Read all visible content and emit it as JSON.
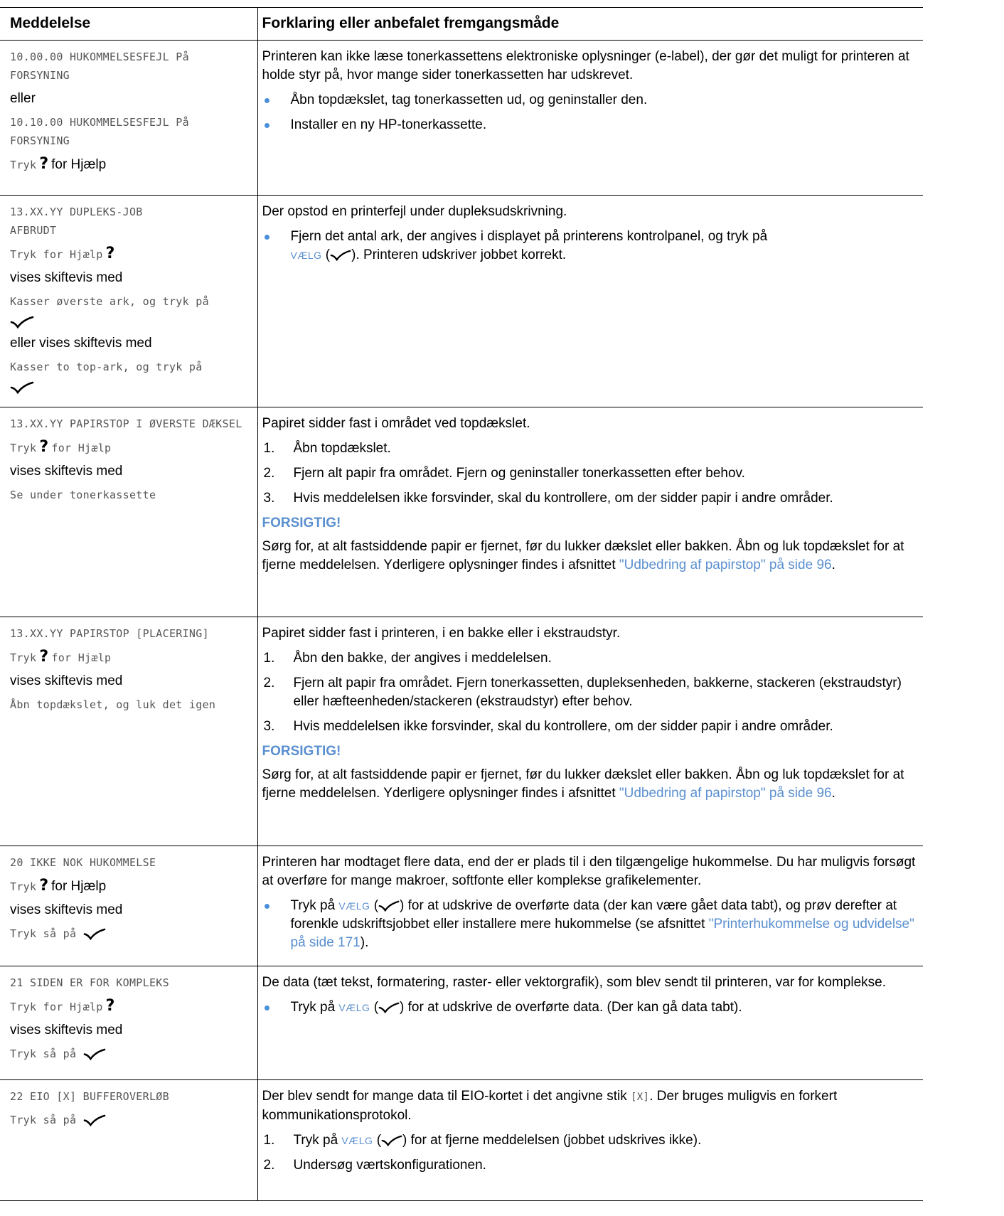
{
  "header": {
    "col1": "Meddelelse",
    "col2": "Forklaring eller anbefalet fremgangsmåde"
  },
  "rows": {
    "r1": {
      "m1": "10.00.00 HUKOMMELSESFEJL På FORSYNING",
      "or": "eller",
      "m2": "10.10.00 HUKOMMELSESFEJL På FORSYNING",
      "help_pre": "Tryk",
      "help_post": "for Hjælp",
      "desc": "Printeren kan ikke læse tonerkassettens elektroniske oplysninger (e-label), der gør det muligt for printeren at holde styr på, hvor mange sider tonerkassetten har udskrevet.",
      "b1": "Åbn topdækslet, tag tonerkassetten ud, og geninstaller den.",
      "b2": "Installer en ny HP-tonerkassette."
    },
    "r2": {
      "m1": "13.XX.YY DUPLEKS-JOB AFBRUDT",
      "help": "Tryk for Hjælp",
      "alt": "vises skiftevis med",
      "m2": "Kasser øverste ark, og tryk på",
      "alt2": "eller vises skiftevis med",
      "m3": "Kasser to top-ark, og tryk på",
      "desc": "Der opstod en printerfejl under dupleksudskrivning.",
      "b1a": "Fjern det antal ark, der angives i displayet på printerens kontrolpanel, og tryk på",
      "key": "VÆLG",
      "b1b": ". Printeren udskriver jobbet korrekt."
    },
    "r3": {
      "m1": "13.XX.YY PAPIRSTOP I ØVERSTE DÆKSEL",
      "help_pre": "Tryk",
      "help_post": "for Hjælp",
      "alt": "vises skiftevis med",
      "m2": "Se under tonerkassette",
      "desc": "Papiret sidder fast i området ved topdækslet.",
      "s1": "Åbn topdækslet.",
      "s2": "Fjern alt papir fra området. Fjern og geninstaller tonerkassetten efter behov.",
      "s3": "Hvis meddelelsen ikke forsvinder, skal du kontrollere, om der sidder papir i andre områder.",
      "caution": "FORSIGTIG!",
      "ctext": "Sørg for, at alt fastsiddende papir er fjernet, før du lukker dækslet eller bakken. Åbn og luk topdækslet for at fjerne meddelelsen. Yderligere oplysninger findes i afsnittet",
      "link": "\"Udbedring af papirstop\" på side 96"
    },
    "r4": {
      "m1": "13.XX.YY PAPIRSTOP [PLACERING]",
      "help_pre": "Tryk",
      "help_post": "for Hjælp",
      "alt": "vises skiftevis med",
      "m2": "Åbn topdækslet, og luk det igen",
      "desc": "Papiret sidder fast i printeren, i en bakke eller i ekstraudstyr.",
      "s1": "Åbn den bakke, der angives i meddelelsen.",
      "s2": "Fjern alt papir fra området. Fjern tonerkassetten, dupleksenheden, bakkerne, stackeren (ekstraudstyr) eller hæfteenheden/stackeren (ekstraudstyr) efter behov.",
      "s3": "Hvis meddelelsen ikke forsvinder, skal du kontrollere, om der sidder papir i andre områder.",
      "caution": "FORSIGTIG!",
      "ctext": "Sørg for, at alt fastsiddende papir er fjernet, før du lukker dækslet eller bakken. Åbn og luk topdækslet for at fjerne meddelelsen. Yderligere oplysninger findes i afsnittet",
      "link": "\"Udbedring af papirstop\" på side 96"
    },
    "r5": {
      "m1": "20 IKKE NOK HUKOMMELSE",
      "help_pre": "Tryk",
      "help_post": "for Hjælp",
      "alt": "vises skiftevis med",
      "m2": "Tryk så på",
      "desc": "Printeren har modtaget flere data, end der er plads til i den tilgængelige hukommelse. Du har muligvis forsøgt at overføre for mange makroer, softfonte eller komplekse grafikelementer.",
      "b1a": "Tryk på",
      "key": "VÆLG",
      "b1b": "for at udskrive de overførte data (der kan være gået data tabt), og prøv derefter at forenkle udskriftsjobbet eller installere mere hukommelse (se afsnittet",
      "link": "\"Printerhukommelse og udvidelse\" på side 171",
      "b1c": ")."
    },
    "r6": {
      "m1": "21 SIDEN ER FOR KOMPLEKS",
      "help": "Tryk for Hjælp",
      "alt": "vises skiftevis med",
      "m2": "Tryk så på",
      "desc": "De data (tæt tekst, formatering, raster- eller vektorgrafik), som blev sendt til printeren, var for komplekse.",
      "b1a": "Tryk på",
      "key": "VÆLG",
      "b1b": "for at udskrive de overførte data. (Der kan gå data tabt)."
    },
    "r7": {
      "m1": "22 EIO [X] BUFFEROVERLØB",
      "m2": "Tryk så på",
      "desc_a": "Der blev sendt for mange data til EIO-kortet i det angivne stik",
      "desc_code": "[X]",
      "desc_b": ". Der bruges muligvis en forkert kommunikationsprotokol.",
      "s1a": "Tryk på",
      "key": "VÆLG",
      "s1b": "for at fjerne meddelelsen (jobbet udskrives ikke).",
      "s2": "Undersøg værtskonfigurationen."
    }
  },
  "colors": {
    "accent": "#5a8fd0",
    "bullet": "#4a90d9",
    "mono_text": "#555555"
  },
  "icons": [
    "help-question-icon",
    "checkmark-icon",
    "bullet-icon"
  ]
}
